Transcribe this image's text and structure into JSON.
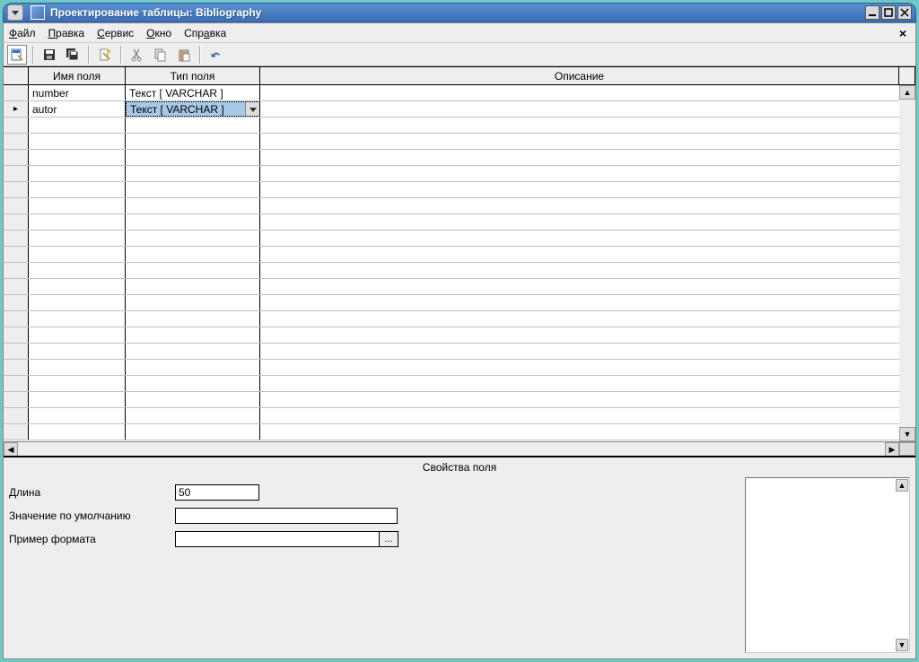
{
  "window": {
    "title": "Проектирование таблицы: Bibliography"
  },
  "menu": {
    "file": "Файл",
    "edit": "Правка",
    "service": "Сервис",
    "window": "Окно",
    "help": "Справка"
  },
  "grid": {
    "headers": {
      "name": "Имя поля",
      "type": "Тип поля",
      "desc": "Описание"
    },
    "rows": [
      {
        "marker": "",
        "name": "number",
        "type": "Текст [ VARCHAR ]",
        "desc": "",
        "selected": false
      },
      {
        "marker": "▶",
        "name": "autor",
        "type": "Текст [ VARCHAR ]",
        "desc": "",
        "selected": true
      }
    ]
  },
  "props": {
    "title": "Свойства поля",
    "length_label": "Длина",
    "length_value": "50",
    "default_label": "Значение по умолчанию",
    "default_value": "",
    "format_label": "Пример формата",
    "format_value": "",
    "format_btn": "..."
  }
}
